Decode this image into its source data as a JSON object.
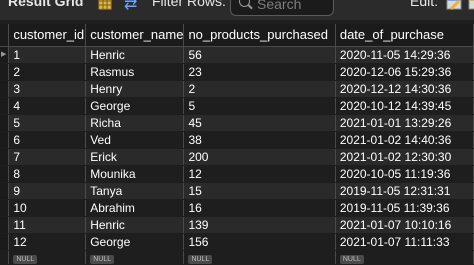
{
  "toolbar": {
    "title": "Result Grid",
    "filter_label": "Filter Rows:",
    "search_placeholder": "Search",
    "edit_label": "Edit:"
  },
  "columns": [
    "customer_id",
    "customer_name",
    "no_products_purchased",
    "date_of_purchase"
  ],
  "rows": [
    [
      "1",
      "Henric",
      "56",
      "2020-11-05 14:29:36"
    ],
    [
      "2",
      "Rasmus",
      "23",
      "2020-12-06 15:29:36"
    ],
    [
      "3",
      "Henry",
      "2",
      "2020-12-12 14:30:36"
    ],
    [
      "4",
      "George",
      "5",
      "2020-10-12 14:39:45"
    ],
    [
      "5",
      "Richa",
      "45",
      "2021-01-01 13:29:26"
    ],
    [
      "6",
      "Ved",
      "38",
      "2021-01-02 14:40:36"
    ],
    [
      "7",
      "Erick",
      "200",
      "2021-01-02 12:30:30"
    ],
    [
      "8",
      "Mounika",
      "12",
      "2020-10-05 11:19:36"
    ],
    [
      "9",
      "Tanya",
      "15",
      "2019-11-05 12:31:31"
    ],
    [
      "10",
      "Abrahim",
      "16",
      "2019-11-05 11:39:36"
    ],
    [
      "11",
      "Henric",
      "139",
      "2021-01-07 10:10:16"
    ],
    [
      "12",
      "George",
      "156",
      "2021-01-07 11:11:33"
    ]
  ],
  "null_labels": [
    "NULL",
    "NULL",
    "NULL",
    "NULL"
  ],
  "current_row_marker": "▶",
  "icons": {
    "grid": "grid-icon",
    "refresh": "refresh-icon",
    "search": "search-icon",
    "edit_grid": "edit-grid-icon",
    "edit_row": "edit-row-icon"
  }
}
